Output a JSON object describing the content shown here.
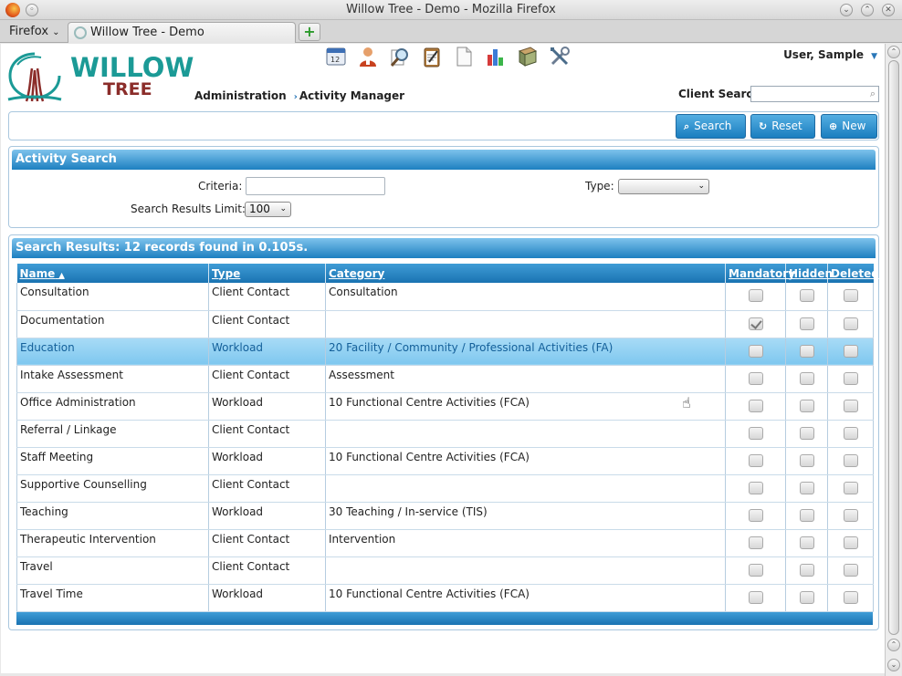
{
  "window": {
    "title": "Willow Tree - Demo - Mozilla Firefox",
    "menu_label": "Firefox",
    "tab_label": "Willow Tree - Demo",
    "new_tab_label": "+"
  },
  "header": {
    "logo_line1": "WILLOW",
    "logo_line2": "TREE",
    "user_label": "User, Sample",
    "breadcrumb": [
      "Administration",
      "Activity Manager"
    ],
    "client_search_label": "Client Search",
    "client_search_value": "",
    "toolbar_icons": [
      "calendar-icon",
      "client-icon",
      "search-docs-icon",
      "clipboard-icon",
      "document-icon",
      "chart-icon",
      "book-icon",
      "tools-icon"
    ]
  },
  "actions": {
    "search_label": "Search",
    "reset_label": "Reset",
    "new_label": "New"
  },
  "search_panel": {
    "title": "Activity Search",
    "criteria_label": "Criteria:",
    "criteria_value": "",
    "type_label": "Type:",
    "type_value": "",
    "limit_label": "Search Results Limit:",
    "limit_value": "100"
  },
  "results": {
    "title": "Search Results: 12 records found in 0.105s.",
    "columns": [
      "Name",
      "Type",
      "Category",
      "Mandatory",
      "Hidden",
      "Deleted"
    ],
    "sort_indicator": "▲",
    "rows": [
      {
        "name": "Consultation",
        "type": "Client Contact",
        "category": "Consultation",
        "mandatory": false,
        "hidden": false,
        "deleted": false
      },
      {
        "name": "Documentation",
        "type": "Client Contact",
        "category": "",
        "mandatory": true,
        "hidden": false,
        "deleted": false
      },
      {
        "name": "Education",
        "type": "Workload",
        "category": "20 Facility / Community / Professional Activities (FA)",
        "mandatory": false,
        "hidden": false,
        "deleted": false,
        "highlighted": true
      },
      {
        "name": "Intake Assessment",
        "type": "Client Contact",
        "category": "Assessment",
        "mandatory": false,
        "hidden": false,
        "deleted": false
      },
      {
        "name": "Office Administration",
        "type": "Workload",
        "category": "10 Functional Centre Activities (FCA)",
        "mandatory": false,
        "hidden": false,
        "deleted": false
      },
      {
        "name": "Referral / Linkage",
        "type": "Client Contact",
        "category": "",
        "mandatory": false,
        "hidden": false,
        "deleted": false
      },
      {
        "name": "Staff Meeting",
        "type": "Workload",
        "category": "10 Functional Centre Activities (FCA)",
        "mandatory": false,
        "hidden": false,
        "deleted": false
      },
      {
        "name": "Supportive Counselling",
        "type": "Client Contact",
        "category": "",
        "mandatory": false,
        "hidden": false,
        "deleted": false
      },
      {
        "name": "Teaching",
        "type": "Workload",
        "category": "30 Teaching / In-service (TIS)",
        "mandatory": false,
        "hidden": false,
        "deleted": false
      },
      {
        "name": "Therapeutic Intervention",
        "type": "Client Contact",
        "category": "Intervention",
        "mandatory": false,
        "hidden": false,
        "deleted": false
      },
      {
        "name": "Travel",
        "type": "Client Contact",
        "category": "",
        "mandatory": false,
        "hidden": false,
        "deleted": false
      },
      {
        "name": "Travel Time",
        "type": "Workload",
        "category": "10 Functional Centre Activities (FCA)",
        "mandatory": false,
        "hidden": false,
        "deleted": false
      }
    ]
  },
  "colors": {
    "accent": "#1a7ebf",
    "logo_green": "#1b9a96",
    "logo_red": "#8b2d2a",
    "row_highlight": "#8fd0f2"
  }
}
